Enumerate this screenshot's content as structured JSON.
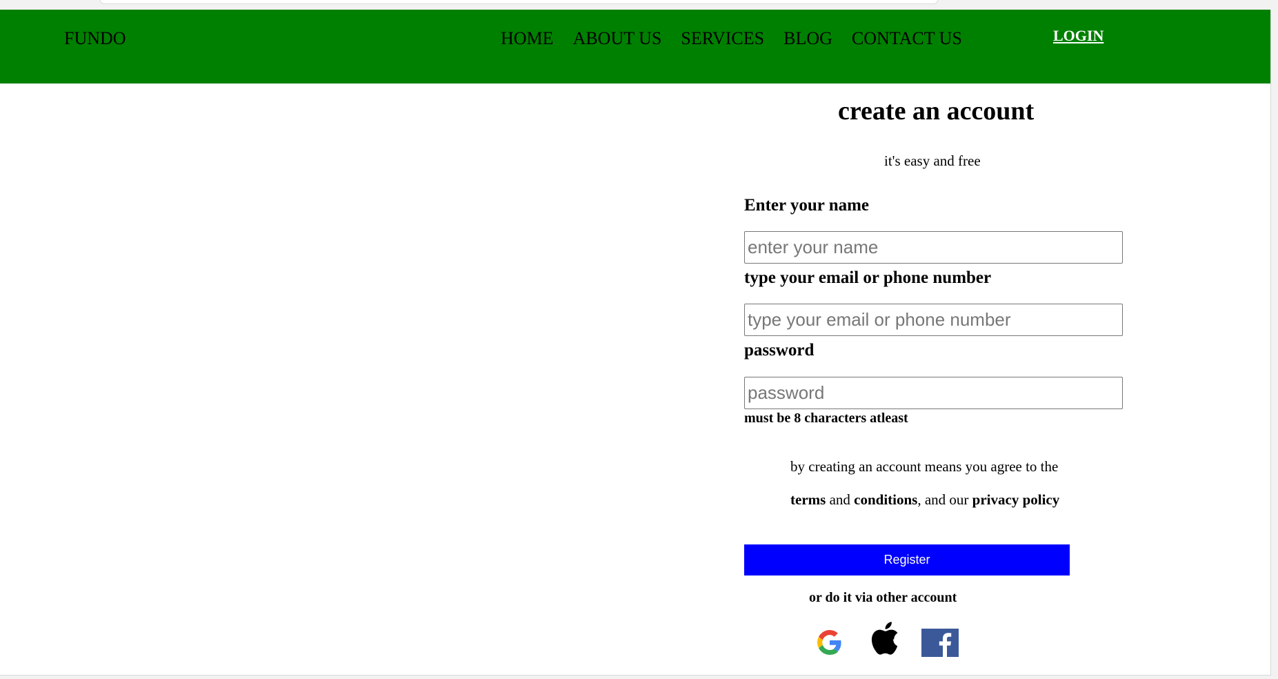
{
  "header": {
    "brand": "FUNDO",
    "nav": [
      "HOME",
      "ABOUT US",
      "SERVICES",
      "BLOG",
      "CONTACT US"
    ],
    "login": "LOGIN",
    "background_color": "#008000"
  },
  "form": {
    "title": "create an account",
    "subtitle": "it's easy and free",
    "name_label": "Enter your name",
    "name_placeholder": "enter your name",
    "email_label": "type your email or phone number",
    "email_placeholder": "type your email or phone number",
    "password_label": "password",
    "password_placeholder": "password",
    "password_hint": "must be 8 characters atleast",
    "terms_line1": "by creating an account means you agree to the",
    "terms_word": "terms",
    "and_word": " and ",
    "conditions_word": "conditions",
    "and_our": ", and our ",
    "privacy_word": "privacy policy",
    "register_label": "Register",
    "register_color": "#0000ff",
    "alt_text": "or do it via other account"
  },
  "social": {
    "icons": [
      "google-icon",
      "apple-icon",
      "facebook-icon"
    ],
    "facebook_color": "#3b5998"
  }
}
